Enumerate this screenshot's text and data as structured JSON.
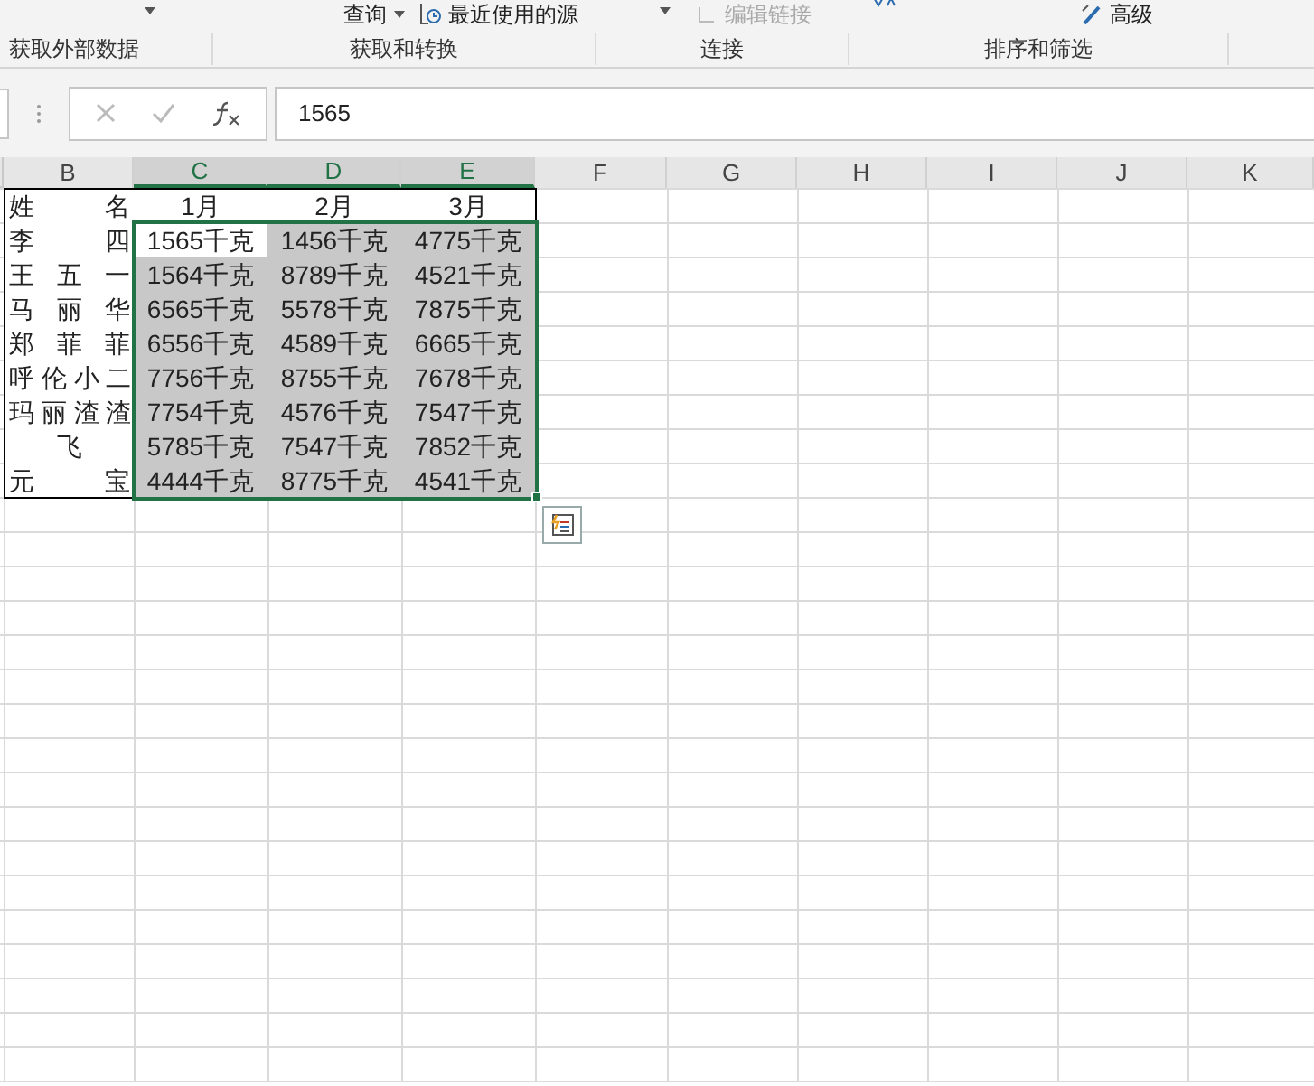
{
  "ribbon": {
    "commands": [
      {
        "label": "查询",
        "caret": true,
        "disabled": false
      },
      {
        "label": "最近使用的源",
        "caret": false,
        "disabled": false
      },
      {
        "label": "编辑链接",
        "caret": false,
        "disabled": true
      },
      {
        "label": "高级",
        "caret": false,
        "disabled": false
      }
    ],
    "groups": [
      "获取外部数据",
      "获取和转换",
      "连接",
      "排序和筛选"
    ]
  },
  "formula_bar": {
    "value": "1565"
  },
  "columns": [
    {
      "label": "B",
      "selected": false
    },
    {
      "label": "C",
      "selected": true
    },
    {
      "label": "D",
      "selected": true
    },
    {
      "label": "E",
      "selected": true
    },
    {
      "label": "F",
      "selected": false
    },
    {
      "label": "G",
      "selected": false
    },
    {
      "label": "H",
      "selected": false
    },
    {
      "label": "I",
      "selected": false
    },
    {
      "label": "J",
      "selected": false
    },
    {
      "label": "K",
      "selected": false
    }
  ],
  "table": {
    "header": [
      "姓 名",
      "1月",
      "2月",
      "3月"
    ],
    "rows": [
      {
        "name": "李 四",
        "cells": [
          {
            "text": "1565千克",
            "active": true
          },
          {
            "text": "1456千克",
            "active": false
          },
          {
            "text": "4775千克",
            "active": false
          }
        ]
      },
      {
        "name": "王 五 一",
        "cells": [
          {
            "text": "1564千克",
            "active": false
          },
          {
            "text": "8789千克",
            "active": false
          },
          {
            "text": "4521千克",
            "active": false
          }
        ]
      },
      {
        "name": "马 丽 华",
        "cells": [
          {
            "text": "6565千克",
            "active": false
          },
          {
            "text": "5578千克",
            "active": false
          },
          {
            "text": "7875千克",
            "active": false
          }
        ]
      },
      {
        "name": "郑 菲 菲",
        "cells": [
          {
            "text": "6556千克",
            "active": false
          },
          {
            "text": "4589千克",
            "active": false
          },
          {
            "text": "6665千克",
            "active": false
          }
        ]
      },
      {
        "name": "呼 伦 小 二",
        "cells": [
          {
            "text": "7756千克",
            "active": false
          },
          {
            "text": "8755千克",
            "active": false
          },
          {
            "text": "7678千克",
            "active": false
          }
        ]
      },
      {
        "name": "玛 丽 渣 渣",
        "cells": [
          {
            "text": "7754千克",
            "active": false
          },
          {
            "text": "4576千克",
            "active": false
          },
          {
            "text": "7547千克",
            "active": false
          }
        ]
      },
      {
        "name": "飞",
        "cells": [
          {
            "text": "5785千克",
            "active": false
          },
          {
            "text": "7547千克",
            "active": false
          },
          {
            "text": "7852千克",
            "active": false
          }
        ]
      },
      {
        "name": "元 宝",
        "cells": [
          {
            "text": "4444千克",
            "active": false
          },
          {
            "text": "8775千克",
            "active": false
          },
          {
            "text": "4541千克",
            "active": false
          }
        ]
      }
    ]
  }
}
